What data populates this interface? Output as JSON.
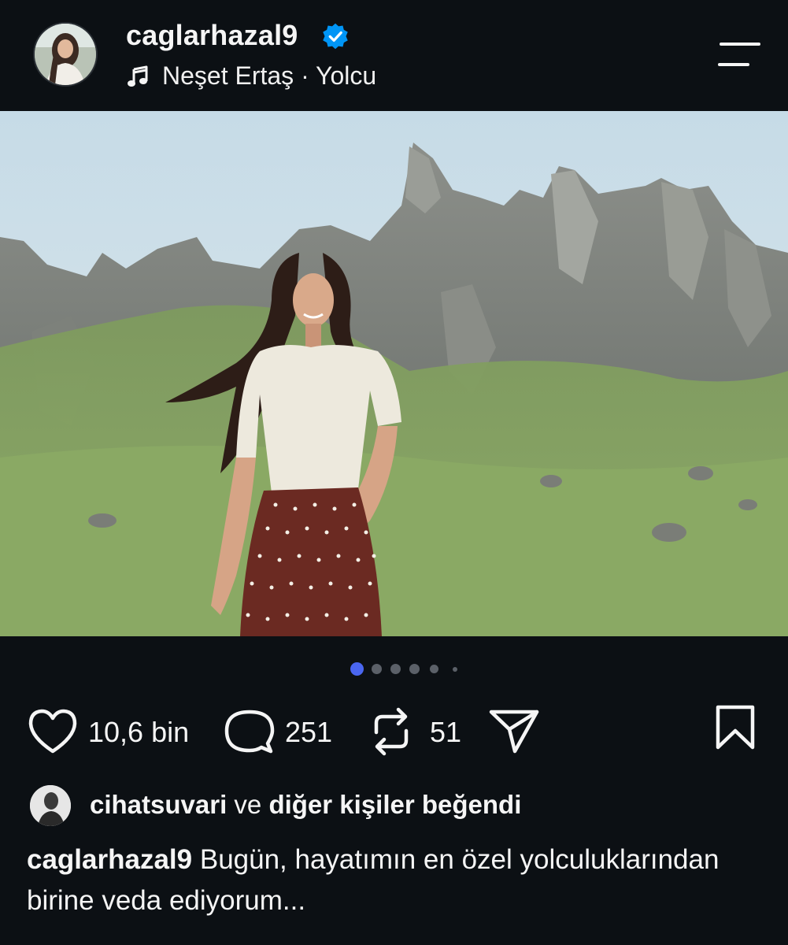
{
  "header": {
    "username": "caglarhazal9",
    "verified": true,
    "song": "Neşet Ertaş · Yolcu"
  },
  "carousel": {
    "total": 6,
    "current": 1
  },
  "actions": {
    "likes": "10,6 bin",
    "comments": "251",
    "reposts": "51"
  },
  "liked_by": {
    "user": "cihatsuvari",
    "connector": " ve ",
    "rest": "diğer kişiler beğendi"
  },
  "caption": {
    "user": "caglarhazal9",
    "text": " Bugün, hayatımın en özel yolculuklarından birine veda ediyorum..."
  },
  "colors": {
    "background": "#0c1014",
    "verified": "#0095f6",
    "active_dot": "#4a66f0"
  }
}
